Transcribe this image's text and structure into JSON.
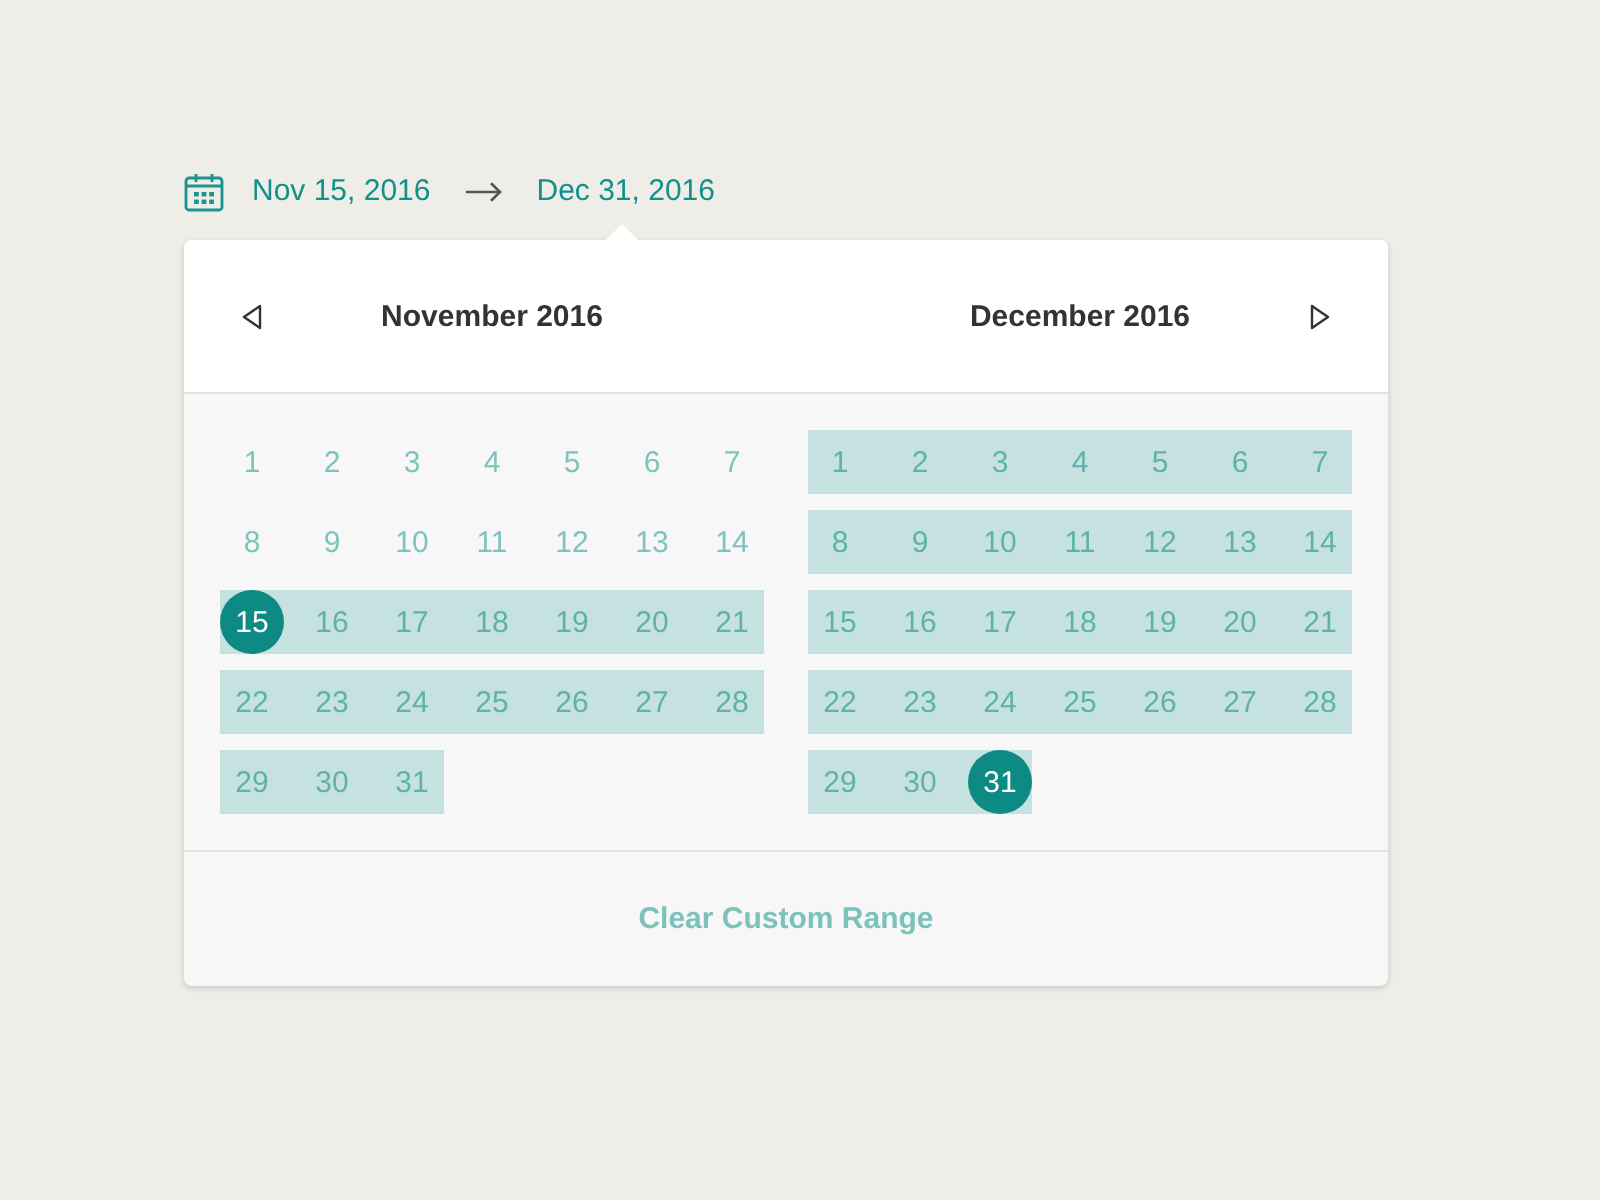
{
  "date_range": {
    "start": "Nov 15, 2016",
    "end": "Dec 31, 2016"
  },
  "months": [
    {
      "title": "November 2016",
      "days": [
        {
          "label": "1",
          "in_range": false,
          "selected": false
        },
        {
          "label": "2",
          "in_range": false,
          "selected": false
        },
        {
          "label": "3",
          "in_range": false,
          "selected": false
        },
        {
          "label": "4",
          "in_range": false,
          "selected": false
        },
        {
          "label": "5",
          "in_range": false,
          "selected": false
        },
        {
          "label": "6",
          "in_range": false,
          "selected": false
        },
        {
          "label": "7",
          "in_range": false,
          "selected": false
        },
        {
          "label": "8",
          "in_range": false,
          "selected": false
        },
        {
          "label": "9",
          "in_range": false,
          "selected": false
        },
        {
          "label": "10",
          "in_range": false,
          "selected": false
        },
        {
          "label": "11",
          "in_range": false,
          "selected": false
        },
        {
          "label": "12",
          "in_range": false,
          "selected": false
        },
        {
          "label": "13",
          "in_range": false,
          "selected": false
        },
        {
          "label": "14",
          "in_range": false,
          "selected": false
        },
        {
          "label": "15",
          "in_range": true,
          "selected": true
        },
        {
          "label": "16",
          "in_range": true,
          "selected": false
        },
        {
          "label": "17",
          "in_range": true,
          "selected": false
        },
        {
          "label": "18",
          "in_range": true,
          "selected": false
        },
        {
          "label": "19",
          "in_range": true,
          "selected": false
        },
        {
          "label": "20",
          "in_range": true,
          "selected": false
        },
        {
          "label": "21",
          "in_range": true,
          "selected": false
        },
        {
          "label": "22",
          "in_range": true,
          "selected": false
        },
        {
          "label": "23",
          "in_range": true,
          "selected": false
        },
        {
          "label": "24",
          "in_range": true,
          "selected": false
        },
        {
          "label": "25",
          "in_range": true,
          "selected": false
        },
        {
          "label": "26",
          "in_range": true,
          "selected": false
        },
        {
          "label": "27",
          "in_range": true,
          "selected": false
        },
        {
          "label": "28",
          "in_range": true,
          "selected": false
        },
        {
          "label": "29",
          "in_range": true,
          "selected": false
        },
        {
          "label": "30",
          "in_range": true,
          "selected": false
        },
        {
          "label": "31",
          "in_range": true,
          "selected": false
        }
      ]
    },
    {
      "title": "December 2016",
      "days": [
        {
          "label": "1",
          "in_range": true,
          "selected": false
        },
        {
          "label": "2",
          "in_range": true,
          "selected": false
        },
        {
          "label": "3",
          "in_range": true,
          "selected": false
        },
        {
          "label": "4",
          "in_range": true,
          "selected": false
        },
        {
          "label": "5",
          "in_range": true,
          "selected": false
        },
        {
          "label": "6",
          "in_range": true,
          "selected": false
        },
        {
          "label": "7",
          "in_range": true,
          "selected": false
        },
        {
          "label": "8",
          "in_range": true,
          "selected": false
        },
        {
          "label": "9",
          "in_range": true,
          "selected": false
        },
        {
          "label": "10",
          "in_range": true,
          "selected": false
        },
        {
          "label": "11",
          "in_range": true,
          "selected": false
        },
        {
          "label": "12",
          "in_range": true,
          "selected": false
        },
        {
          "label": "13",
          "in_range": true,
          "selected": false
        },
        {
          "label": "14",
          "in_range": true,
          "selected": false
        },
        {
          "label": "15",
          "in_range": true,
          "selected": false
        },
        {
          "label": "16",
          "in_range": true,
          "selected": false
        },
        {
          "label": "17",
          "in_range": true,
          "selected": false
        },
        {
          "label": "18",
          "in_range": true,
          "selected": false
        },
        {
          "label": "19",
          "in_range": true,
          "selected": false
        },
        {
          "label": "20",
          "in_range": true,
          "selected": false
        },
        {
          "label": "21",
          "in_range": true,
          "selected": false
        },
        {
          "label": "22",
          "in_range": true,
          "selected": false
        },
        {
          "label": "23",
          "in_range": true,
          "selected": false
        },
        {
          "label": "24",
          "in_range": true,
          "selected": false
        },
        {
          "label": "25",
          "in_range": true,
          "selected": false
        },
        {
          "label": "26",
          "in_range": true,
          "selected": false
        },
        {
          "label": "27",
          "in_range": true,
          "selected": false
        },
        {
          "label": "28",
          "in_range": true,
          "selected": false
        },
        {
          "label": "29",
          "in_range": true,
          "selected": false
        },
        {
          "label": "30",
          "in_range": true,
          "selected": false
        },
        {
          "label": "31",
          "in_range": true,
          "selected": true
        }
      ]
    }
  ],
  "footer": {
    "clear_link": "Clear Custom Range"
  }
}
